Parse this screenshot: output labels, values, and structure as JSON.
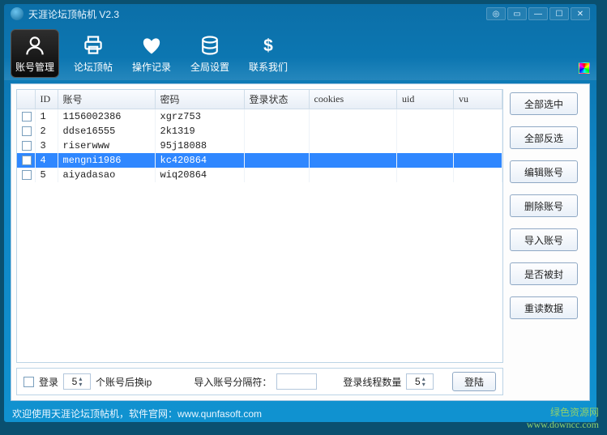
{
  "title": "天涯论坛顶帖机  V2.3",
  "toolbar": [
    {
      "label": "账号管理",
      "icon": "user",
      "active": true
    },
    {
      "label": "论坛顶帖",
      "icon": "printer",
      "active": false
    },
    {
      "label": "操作记录",
      "icon": "heart",
      "active": false
    },
    {
      "label": "全局设置",
      "icon": "db",
      "active": false
    },
    {
      "label": "联系我们",
      "icon": "dollar",
      "active": false
    }
  ],
  "table": {
    "headers": [
      "ID",
      "账号",
      "密码",
      "登录状态",
      "cookies",
      "uid",
      "vu"
    ],
    "rows": [
      {
        "id": "1",
        "acc": "1156002386",
        "pwd": "xgrz753",
        "stat": "",
        "cookies": "",
        "uid": "",
        "vu": "",
        "selected": false
      },
      {
        "id": "2",
        "acc": "ddse16555",
        "pwd": "2k1319",
        "stat": "",
        "cookies": "",
        "uid": "",
        "vu": "",
        "selected": false
      },
      {
        "id": "3",
        "acc": "riserwww",
        "pwd": "95j18088",
        "stat": "",
        "cookies": "",
        "uid": "",
        "vu": "",
        "selected": false
      },
      {
        "id": "4",
        "acc": "mengni1986",
        "pwd": "kc420864",
        "stat": "",
        "cookies": "",
        "uid": "",
        "vu": "",
        "selected": true
      },
      {
        "id": "5",
        "acc": "aiyadasao",
        "pwd": "wiq20864",
        "stat": "",
        "cookies": "",
        "uid": "",
        "vu": "",
        "selected": false
      }
    ]
  },
  "side_buttons": [
    "全部选中",
    "全部反选",
    "编辑账号",
    "删除账号",
    "导入账号",
    "是否被封",
    "重读数据"
  ],
  "bottom": {
    "login_cb": "登录",
    "login_num": "5",
    "after_ip": "个账号后换ip",
    "sep_label": "导入账号分隔符：",
    "sep_value": "",
    "threads_label": "登录线程数量",
    "threads_value": "5",
    "login_btn": "登陆"
  },
  "status": "欢迎使用天涯论坛顶帖机，软件官网：www.qunfasoft.com",
  "watermark": {
    "line1": "绿色资源网",
    "line2": "www.downcc.com"
  }
}
